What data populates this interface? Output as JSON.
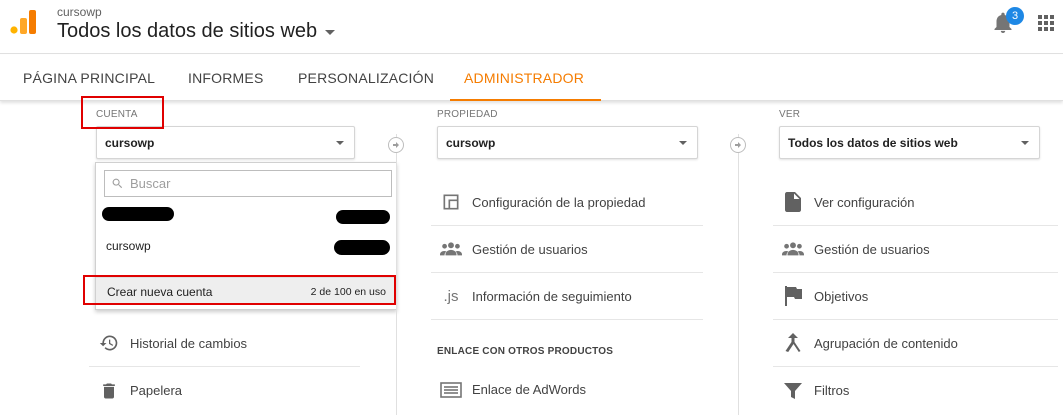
{
  "header": {
    "account_name": "cursowp",
    "view_title": "Todos los datos de sitios web",
    "notifications_count": "3"
  },
  "nav": {
    "tabs": [
      {
        "label": "PÁGINA PRINCIPAL",
        "active": false
      },
      {
        "label": "INFORMES",
        "active": false
      },
      {
        "label": "PERSONALIZACIÓN",
        "active": false
      },
      {
        "label": "ADMINISTRADOR",
        "active": true
      }
    ]
  },
  "cuenta": {
    "label": "CUENTA",
    "selected": "cursowp",
    "dropdown": {
      "search_placeholder": "Buscar",
      "accounts": [
        {
          "name": "[redacted]",
          "redacted": true
        },
        {
          "name": "cursowp",
          "redacted": false
        }
      ],
      "create_label": "Crear nueva cuenta",
      "usage": "2 de 100 en uso"
    },
    "items": [
      {
        "label": "Historial de cambios",
        "icon": "history-icon"
      },
      {
        "label": "Papelera",
        "icon": "trash-icon"
      }
    ]
  },
  "propiedad": {
    "label": "PROPIEDAD",
    "selected": "cursowp",
    "items": [
      {
        "label": "Configuración de la propiedad",
        "icon": "property-settings-icon"
      },
      {
        "label": "Gestión de usuarios",
        "icon": "users-icon"
      },
      {
        "label": "Información de seguimiento",
        "icon": "js-icon",
        "icon_text": ".js"
      }
    ],
    "section_heading": "ENLACE CON OTROS PRODUCTOS",
    "link_items": [
      {
        "label": "Enlace de AdWords",
        "icon": "adwords-icon"
      }
    ]
  },
  "ver": {
    "label": "VER",
    "selected": "Todos los datos de sitios web",
    "items": [
      {
        "label": "Ver configuración",
        "icon": "document-icon"
      },
      {
        "label": "Gestión de usuarios",
        "icon": "users-icon"
      },
      {
        "label": "Objetivos",
        "icon": "flag-icon"
      },
      {
        "label": "Agrupación de contenido",
        "icon": "grouping-icon"
      },
      {
        "label": "Filtros",
        "icon": "filter-icon"
      }
    ]
  },
  "colors": {
    "accent": "#f57c00",
    "badge": "#1e88e5",
    "highlight": "#e00000",
    "logo_dark": "#e65100",
    "logo_light": "#ffb300"
  }
}
